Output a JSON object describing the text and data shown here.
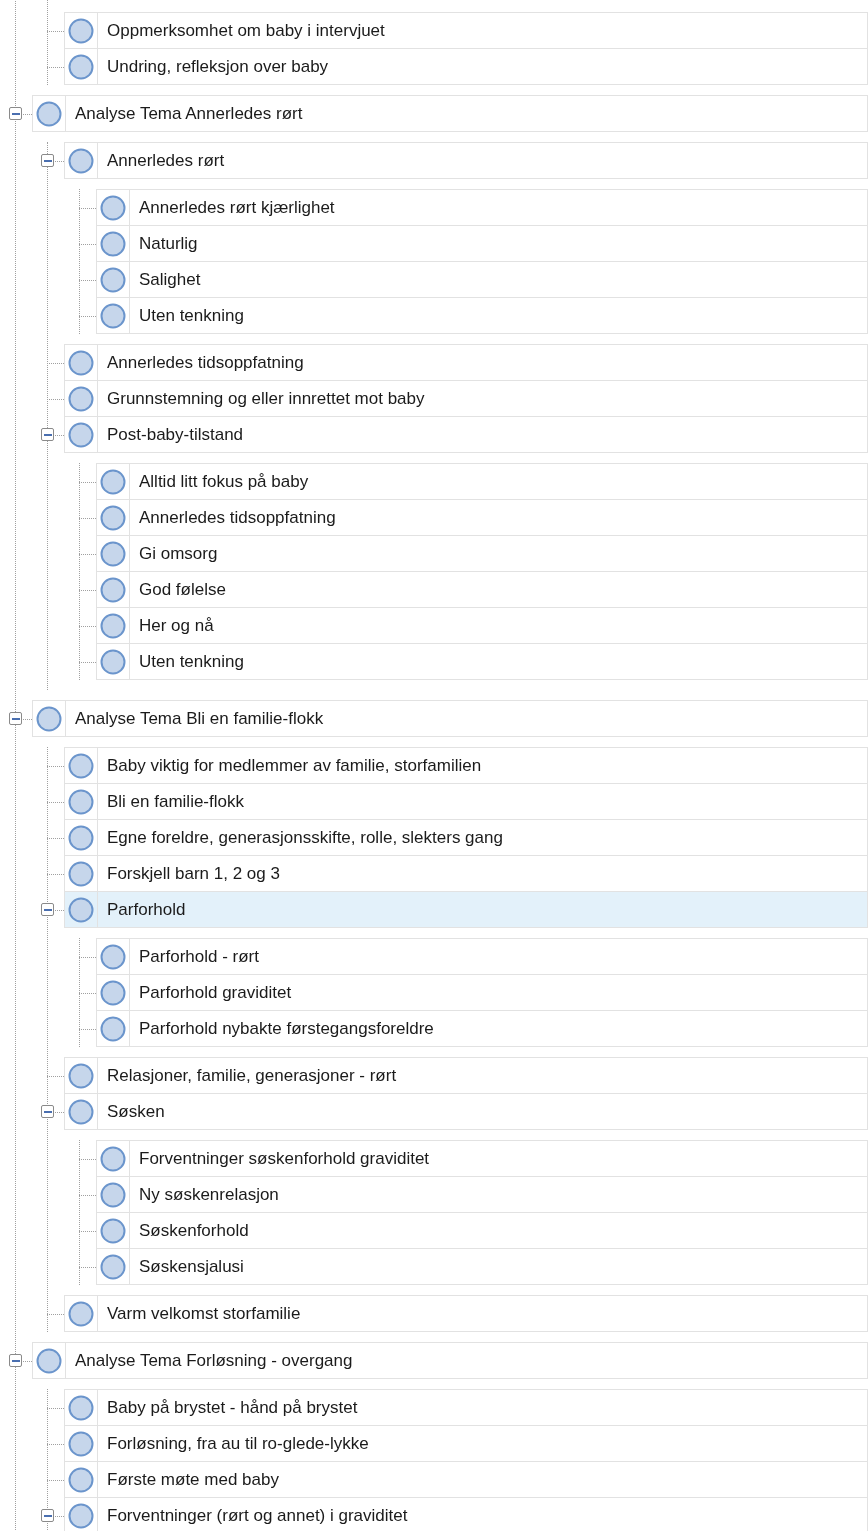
{
  "tree": {
    "partial_top": [
      {
        "label": "Oppmerksomhet om baby i intervjuet",
        "selected": false
      },
      {
        "label": "Undring, refleksjon over baby",
        "selected": false
      }
    ],
    "nodes": [
      {
        "label": "Analyse Tema Annerledes rørt",
        "selected": false,
        "expanded": true,
        "children": [
          {
            "label": "Annerledes rørt",
            "selected": false,
            "expanded": true,
            "children": [
              {
                "label": "Annerledes rørt kjærlighet",
                "selected": false
              },
              {
                "label": "Naturlig",
                "selected": false
              },
              {
                "label": "Salighet",
                "selected": false
              },
              {
                "label": "Uten tenkning",
                "selected": false
              }
            ]
          },
          {
            "label": "Annerledes tidsoppfatning",
            "selected": false
          },
          {
            "label": "Grunnstemning og eller innrettet mot baby",
            "selected": false
          },
          {
            "label": "Post-baby-tilstand",
            "selected": false,
            "expanded": true,
            "children": [
              {
                "label": "Alltid litt fokus på baby",
                "selected": false
              },
              {
                "label": "Annerledes tidsoppfatning",
                "selected": false
              },
              {
                "label": "Gi omsorg",
                "selected": false
              },
              {
                "label": "God følelse",
                "selected": false
              },
              {
                "label": "Her og nå",
                "selected": false
              },
              {
                "label": "Uten tenkning",
                "selected": false
              }
            ]
          }
        ]
      },
      {
        "label": "Analyse Tema Bli en familie-flokk",
        "selected": false,
        "expanded": true,
        "children": [
          {
            "label": "Baby viktig for medlemmer av familie, storfamilien",
            "selected": false
          },
          {
            "label": "Bli en familie-flokk",
            "selected": false
          },
          {
            "label": "Egne foreldre, generasjonsskifte, rolle, slekters gang",
            "selected": false
          },
          {
            "label": "Forskjell barn 1, 2 og 3",
            "selected": false
          },
          {
            "label": "Parforhold",
            "selected": true,
            "expanded": true,
            "children": [
              {
                "label": "Parforhold - rørt",
                "selected": false
              },
              {
                "label": "Parforhold graviditet",
                "selected": false
              },
              {
                "label": "Parforhold nybakte førstegangsforeldre",
                "selected": false
              }
            ]
          },
          {
            "label": "Relasjoner, familie, generasjoner - rørt",
            "selected": false
          },
          {
            "label": "Søsken",
            "selected": false,
            "expanded": true,
            "children": [
              {
                "label": "Forventninger søskenforhold graviditet",
                "selected": false
              },
              {
                "label": "Ny søskenrelasjon",
                "selected": false
              },
              {
                "label": "Søskenforhold",
                "selected": false
              },
              {
                "label": "Søskensjalusi",
                "selected": false
              }
            ]
          },
          {
            "label": "Varm velkomst storfamilie",
            "selected": false
          }
        ]
      },
      {
        "label": "Analyse Tema Forløsning - overgang",
        "selected": false,
        "expanded": true,
        "children": [
          {
            "label": "Baby på brystet - hånd på brystet",
            "selected": false
          },
          {
            "label": "Forløsning, fra au til ro-glede-lykke",
            "selected": false
          },
          {
            "label": "Første møte med baby",
            "selected": false
          },
          {
            "label": "Forventninger (rørt og annet) i graviditet",
            "selected": false,
            "expanded": true
          }
        ]
      }
    ]
  }
}
